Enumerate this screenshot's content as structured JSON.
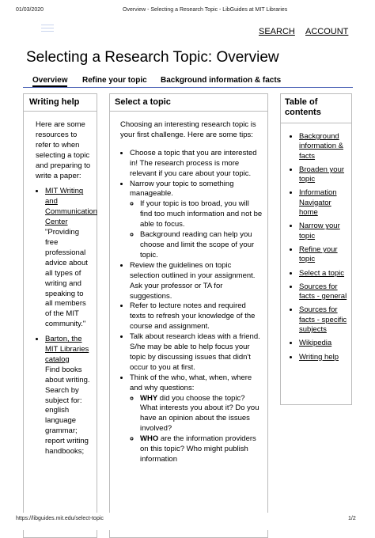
{
  "print_header": {
    "date": "01/03/2020",
    "title": "Overview - Selecting a Research Topic - LibGuides at MIT Libraries"
  },
  "top_nav": {
    "search": "SEARCH",
    "account": "ACCOUNT"
  },
  "page_title": "Selecting a Research Topic: Overview",
  "tabs": [
    "Overview",
    "Refine your topic",
    "Background information & facts"
  ],
  "writing_help": {
    "title": "Writing help",
    "intro": "Here are some resources to refer to when selecting a topic and preparing to write a paper:",
    "items": [
      {
        "link": "MIT Writing and Communication Center",
        "desc": "\"Providing free professional advice about all types of writing and speaking to all members of the MIT community.\""
      },
      {
        "link": "Barton, the MIT Libraries catalog",
        "desc": "Find books about writing. Search by subject for: english language grammar; report writing handbooks;"
      }
    ]
  },
  "select_topic": {
    "title": "Select a topic",
    "intro": "Choosing an interesting research topic is your first challenge. Here are some tips:",
    "bullets": [
      "Choose a topic that you are interested in! The research process is more relevant if you care about your topic.",
      "Narrow your topic to something manageable.",
      "Review the guidelines on topic selection outlined in your assignment.  Ask your professor or TA for suggestions.",
      "Refer to lecture notes and required texts to refresh your knowledge of the course and assignment.",
      "Talk about research ideas with a friend.  S/he may be able to help focus your topic by discussing issues that didn't occur to you at first.",
      "Think of the who, what, when, where and why questions:"
    ],
    "narrow_sub": [
      "If your topic is too broad, you will find too much information and not be able to focus.",
      "Background reading can help you choose and limit the scope of your topic."
    ],
    "questions": [
      {
        "word": "WHY",
        "text": " did you choose the topic?  What interests you about it?  Do you have an opinion about the issues involved?"
      },
      {
        "word": "WHO",
        "text": " are the information providers on this topic?  Who might publish information"
      }
    ]
  },
  "toc": {
    "title": "Table of contents",
    "items": [
      "Background information & facts",
      "Broaden your topic",
      "Information Navigator home",
      "Narrow your topic",
      "Refine your topic",
      "Select a topic",
      "Sources for facts - general",
      "Sources for facts - specific subjects",
      "Wikipedia",
      "Writing help"
    ]
  },
  "footer": {
    "url": "https://libguides.mit.edu/select-topic",
    "page": "1/2"
  }
}
